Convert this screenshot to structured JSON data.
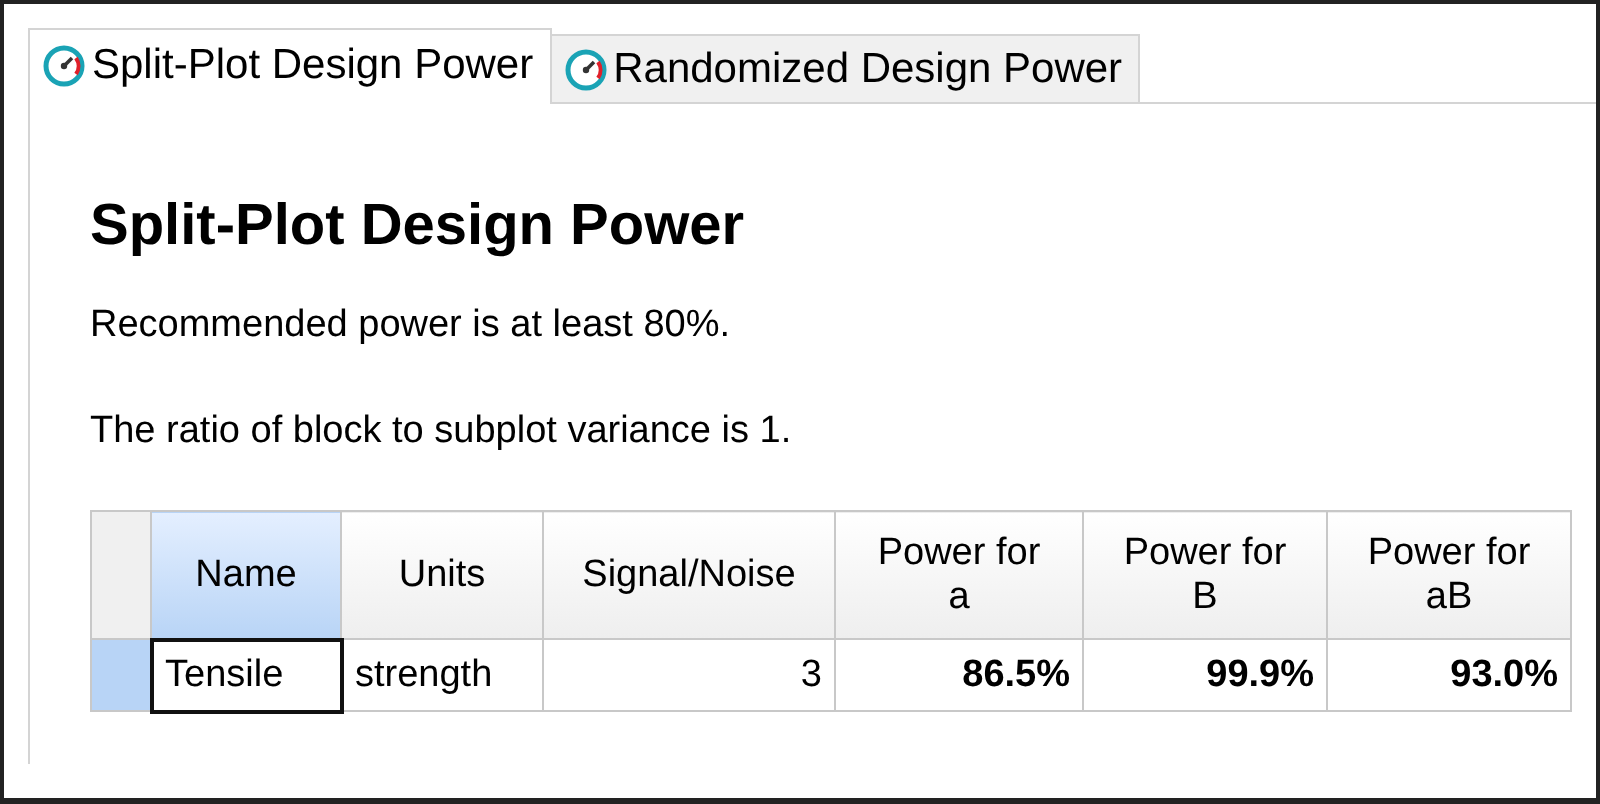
{
  "tabs": [
    {
      "label": "Split-Plot Design Power",
      "selected": true
    },
    {
      "label": "Randomized Design Power",
      "selected": false
    }
  ],
  "heading": "Split-Plot Design Power",
  "paragraphs": [
    "Recommended power is at least 80%.",
    "The ratio of block to subplot variance is 1."
  ],
  "table": {
    "columns": [
      {
        "label": "Name",
        "selected": true,
        "kind": "text"
      },
      {
        "label": "Units",
        "selected": false,
        "kind": "text"
      },
      {
        "label": "Signal/Noise",
        "selected": false,
        "kind": "number"
      },
      {
        "label": "Power for a",
        "selected": false,
        "kind": "power"
      },
      {
        "label": "Power for B",
        "selected": false,
        "kind": "power"
      },
      {
        "label": "Power for aB",
        "selected": false,
        "kind": "power"
      }
    ],
    "rows": [
      {
        "selected": true,
        "cells": [
          {
            "text": "Tensile",
            "focused": true
          },
          {
            "text": "strength",
            "focused": false
          },
          {
            "text": "3",
            "focused": false
          },
          {
            "text": "86.5%",
            "focused": false
          },
          {
            "text": "99.9%",
            "focused": false
          },
          {
            "text": "93.0%",
            "focused": false
          }
        ]
      }
    ]
  }
}
